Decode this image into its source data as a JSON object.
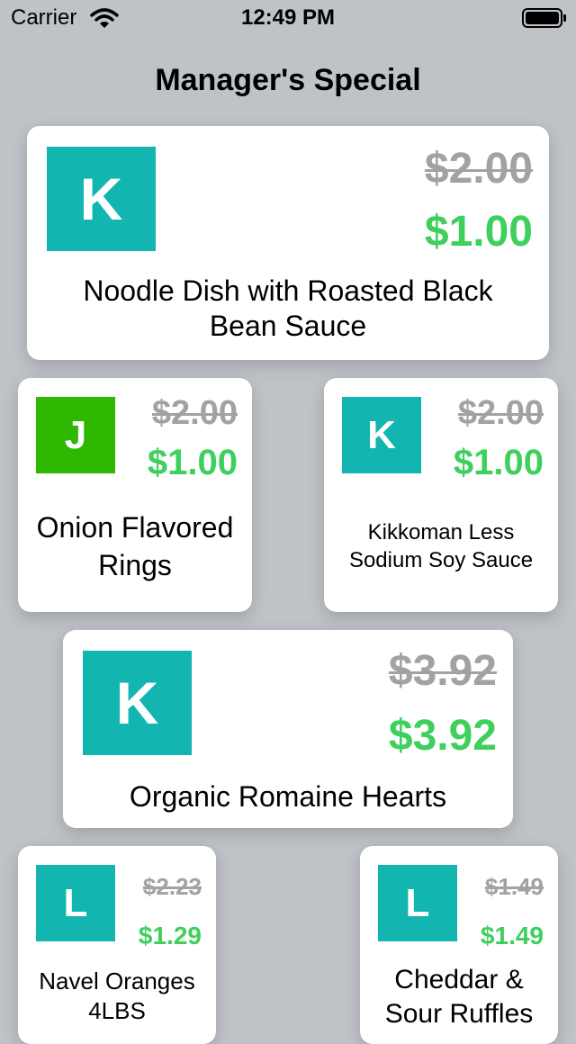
{
  "status": {
    "carrier": "Carrier",
    "time": "12:49 PM"
  },
  "title": "Manager's Special",
  "colors": {
    "teal": "#13b5b1",
    "green": "#2fb800",
    "price_green": "#3fcf5c",
    "old_price_gray": "#a2a2a2"
  },
  "specials": [
    {
      "logo_letter": "K",
      "original_price": "$2.00",
      "price": "$1.00",
      "name": "Noodle Dish with Roasted Black Bean Sauce"
    },
    {
      "logo_letter": "J",
      "original_price": "$2.00",
      "price": "$1.00",
      "name": "Onion Flavored Rings"
    },
    {
      "logo_letter": "K",
      "original_price": "$2.00",
      "price": "$1.00",
      "name": "Kikkoman Less Sodium Soy Sauce"
    },
    {
      "logo_letter": "K",
      "original_price": "$3.92",
      "price": "$3.92",
      "name": "Organic Romaine Hearts"
    },
    {
      "logo_letter": "L",
      "original_price": "$2.23",
      "price": "$1.29",
      "name": "Navel Oranges 4LBS"
    },
    {
      "logo_letter": "L",
      "original_price": "$1.49",
      "price": "$1.49",
      "name": "Cheddar & Sour Ruffles"
    }
  ]
}
